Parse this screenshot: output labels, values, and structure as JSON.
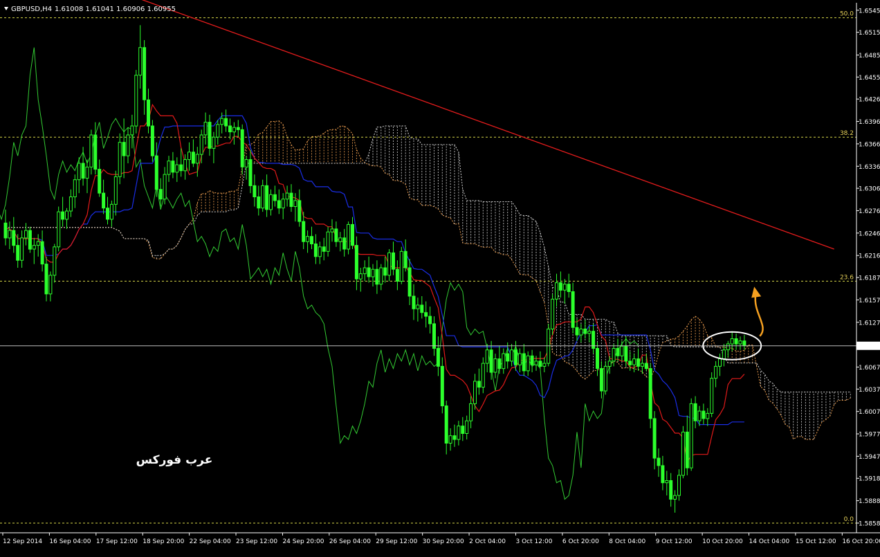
{
  "header": {
    "symbol_text": "GBPUSD,H4",
    "ohlc_text": "1.61008 1.61041 1.60906 1.60955"
  },
  "watermark": "عرب فوركس",
  "colors": {
    "background": "#000000",
    "grid": "#4a4a4a",
    "fib": "#d9d94a",
    "trendline": "#e61c1c",
    "tenkan": "#e31a1a",
    "kijun": "#1a2ee8",
    "chikou": "#33cc33",
    "bull": "#ffffff",
    "bear": "#2cff2c",
    "cloud_a": "#f0a050",
    "cloud_b": "#d8d8d8",
    "annot_arrow": "#f5a020",
    "annot_ellipse": "#ffffff"
  },
  "chart_data": {
    "type": "candlestick",
    "timeframe": "H4",
    "ylim": [
      1.5845,
      1.6555
    ],
    "y_ticks": [
      "1.65450",
      "1.65155",
      "1.64850",
      "1.64555",
      "1.64260",
      "1.63960",
      "1.63660",
      "1.63360",
      "1.63065",
      "1.62765",
      "1.62465",
      "1.62165",
      "1.61870",
      "1.61570",
      "1.61270",
      "1.60955",
      "1.60670",
      "1.60375",
      "1.60075",
      "1.59775",
      "1.59475",
      "1.59180",
      "1.58880",
      "1.58580"
    ],
    "x_ticks": [
      "12 Sep 2014",
      "16 Sep 04:00",
      "17 Sep 12:00",
      "18 Sep 20:00",
      "22 Sep 04:00",
      "23 Sep 12:00",
      "24 Sep 20:00",
      "26 Sep 04:00",
      "29 Sep 12:00",
      "30 Sep 20:00",
      "2 Oct 04:00",
      "3 Oct 12:00",
      "6 Oct 20:00",
      "8 Oct 04:00",
      "9 Oct 12:00",
      "10 Oct 20:00",
      "14 Oct 04:00",
      "15 Oct 12:00",
      "16 Oct 20:00"
    ],
    "current_price": "1.60955",
    "fib_levels": [
      {
        "label": "50.0",
        "price": 1.6535
      },
      {
        "label": "38.2",
        "price": 1.6375
      },
      {
        "label": "23.6",
        "price": 1.6182
      },
      {
        "label": "0.0",
        "price": 1.5858
      }
    ],
    "trendline": {
      "from": {
        "bar": 33,
        "price": 1.656
      },
      "to": {
        "bar": 203,
        "price": 1.6225
      }
    },
    "candles": [
      [
        1.626,
        1.6278,
        1.623,
        1.624
      ],
      [
        1.624,
        1.6262,
        1.6225,
        1.625
      ],
      [
        1.625,
        1.6268,
        1.622,
        1.623
      ],
      [
        1.623,
        1.6245,
        1.62,
        1.621
      ],
      [
        1.621,
        1.625,
        1.62,
        1.624
      ],
      [
        1.624,
        1.626,
        1.623,
        1.625
      ],
      [
        1.625,
        1.6255,
        1.622,
        1.6225
      ],
      [
        1.6225,
        1.624,
        1.6205,
        1.623
      ],
      [
        1.623,
        1.6245,
        1.6215,
        1.6235
      ],
      [
        1.6235,
        1.625,
        1.6195,
        1.6205
      ],
      [
        1.6205,
        1.6215,
        1.6155,
        1.6165
      ],
      [
        1.6165,
        1.6195,
        1.6155,
        1.619
      ],
      [
        1.619,
        1.6232,
        1.618,
        1.6228
      ],
      [
        1.6228,
        1.6282,
        1.6222,
        1.6275
      ],
      [
        1.6275,
        1.6295,
        1.6255,
        1.6265
      ],
      [
        1.6265,
        1.628,
        1.6252,
        1.6276
      ],
      [
        1.6276,
        1.6305,
        1.6268,
        1.6295
      ],
      [
        1.6295,
        1.6325,
        1.628,
        1.6318
      ],
      [
        1.6318,
        1.6348,
        1.63,
        1.634
      ],
      [
        1.634,
        1.6362,
        1.631,
        1.632
      ],
      [
        1.632,
        1.6345,
        1.63,
        1.6335
      ],
      [
        1.6335,
        1.6385,
        1.6325,
        1.6378
      ],
      [
        1.6378,
        1.6395,
        1.6325,
        1.6332
      ],
      [
        1.6332,
        1.6345,
        1.6295,
        1.63
      ],
      [
        1.63,
        1.6318,
        1.6272,
        1.628
      ],
      [
        1.628,
        1.6295,
        1.6258,
        1.6265
      ],
      [
        1.6265,
        1.629,
        1.6255,
        1.6285
      ],
      [
        1.6285,
        1.633,
        1.627,
        1.6322
      ],
      [
        1.6322,
        1.638,
        1.6312,
        1.6368
      ],
      [
        1.6368,
        1.64,
        1.632,
        1.635
      ],
      [
        1.635,
        1.6388,
        1.634,
        1.6378
      ],
      [
        1.6378,
        1.6405,
        1.636,
        1.639
      ],
      [
        1.639,
        1.6465,
        1.638,
        1.6458
      ],
      [
        1.6458,
        1.6525,
        1.644,
        1.6495
      ],
      [
        1.6495,
        1.6505,
        1.6405,
        1.6425
      ],
      [
        1.6425,
        1.644,
        1.638,
        1.639
      ],
      [
        1.639,
        1.6398,
        1.6342,
        1.635
      ],
      [
        1.635,
        1.6368,
        1.6295,
        1.6305
      ],
      [
        1.6305,
        1.632,
        1.6282,
        1.6292
      ],
      [
        1.6292,
        1.6335,
        1.6285,
        1.6325
      ],
      [
        1.6325,
        1.635,
        1.6315,
        1.6343
      ],
      [
        1.6343,
        1.6355,
        1.632,
        1.6328
      ],
      [
        1.6328,
        1.6348,
        1.6315,
        1.6338
      ],
      [
        1.6338,
        1.636,
        1.6322,
        1.633
      ],
      [
        1.633,
        1.6352,
        1.6318,
        1.6345
      ],
      [
        1.6345,
        1.6368,
        1.633,
        1.6355
      ],
      [
        1.6355,
        1.6372,
        1.6335,
        1.634
      ],
      [
        1.634,
        1.6362,
        1.6322,
        1.6352
      ],
      [
        1.6352,
        1.6385,
        1.634,
        1.6378
      ],
      [
        1.6378,
        1.6408,
        1.6365,
        1.6395
      ],
      [
        1.6395,
        1.6405,
        1.635,
        1.636
      ],
      [
        1.636,
        1.6382,
        1.634,
        1.6375
      ],
      [
        1.6375,
        1.6398,
        1.6365,
        1.6392
      ],
      [
        1.6392,
        1.6408,
        1.638,
        1.64
      ],
      [
        1.64,
        1.6412,
        1.6382,
        1.639
      ],
      [
        1.639,
        1.64,
        1.6372,
        1.6382
      ],
      [
        1.6382,
        1.6395,
        1.6365,
        1.6388
      ],
      [
        1.6388,
        1.6398,
        1.6375,
        1.6385
      ],
      [
        1.6385,
        1.6392,
        1.6325,
        1.6335
      ],
      [
        1.6335,
        1.635,
        1.6318,
        1.6345
      ],
      [
        1.6345,
        1.6358,
        1.63,
        1.631
      ],
      [
        1.631,
        1.6325,
        1.6282,
        1.6295
      ],
      [
        1.6295,
        1.631,
        1.627,
        1.628
      ],
      [
        1.628,
        1.6318,
        1.6275,
        1.631
      ],
      [
        1.631,
        1.6325,
        1.6268,
        1.6278
      ],
      [
        1.6278,
        1.6305,
        1.627,
        1.6298
      ],
      [
        1.6298,
        1.631,
        1.6282,
        1.629
      ],
      [
        1.629,
        1.6305,
        1.6272,
        1.628
      ],
      [
        1.628,
        1.63,
        1.6265,
        1.6292
      ],
      [
        1.6292,
        1.631,
        1.6282,
        1.63
      ],
      [
        1.63,
        1.6312,
        1.6275,
        1.6282
      ],
      [
        1.6282,
        1.63,
        1.6262,
        1.629
      ],
      [
        1.629,
        1.6305,
        1.6255,
        1.6262
      ],
      [
        1.6262,
        1.6275,
        1.6225,
        1.6235
      ],
      [
        1.6235,
        1.625,
        1.622,
        1.6242
      ],
      [
        1.6242,
        1.6255,
        1.6225,
        1.6232
      ],
      [
        1.6232,
        1.6245,
        1.6205,
        1.6215
      ],
      [
        1.6215,
        1.6235,
        1.6205,
        1.6228
      ],
      [
        1.6228,
        1.624,
        1.621,
        1.6222
      ],
      [
        1.6222,
        1.6255,
        1.6215,
        1.6248
      ],
      [
        1.6248,
        1.6265,
        1.6235,
        1.6252
      ],
      [
        1.6252,
        1.6262,
        1.6228,
        1.6235
      ],
      [
        1.6235,
        1.6248,
        1.6222,
        1.624
      ],
      [
        1.624,
        1.6252,
        1.6215,
        1.6225
      ],
      [
        1.6225,
        1.6262,
        1.6218,
        1.6258
      ],
      [
        1.6258,
        1.6268,
        1.6225,
        1.623
      ],
      [
        1.623,
        1.6242,
        1.617,
        1.6185
      ],
      [
        1.6185,
        1.62,
        1.6168,
        1.6192
      ],
      [
        1.6192,
        1.621,
        1.6182,
        1.62
      ],
      [
        1.62,
        1.6215,
        1.618,
        1.6188
      ],
      [
        1.6188,
        1.6205,
        1.6175,
        1.6198
      ],
      [
        1.6198,
        1.621,
        1.6165,
        1.6178
      ],
      [
        1.6178,
        1.6205,
        1.617,
        1.62
      ],
      [
        1.62,
        1.6215,
        1.618,
        1.619
      ],
      [
        1.619,
        1.6225,
        1.6182,
        1.622
      ],
      [
        1.622,
        1.6235,
        1.619,
        1.6198
      ],
      [
        1.6198,
        1.621,
        1.617,
        1.6182
      ],
      [
        1.6182,
        1.6228,
        1.6178,
        1.6222
      ],
      [
        1.6222,
        1.6238,
        1.6195,
        1.62
      ],
      [
        1.62,
        1.6212,
        1.615,
        1.6162
      ],
      [
        1.6162,
        1.6178,
        1.613,
        1.6145
      ],
      [
        1.6145,
        1.616,
        1.6128,
        1.615
      ],
      [
        1.615,
        1.6162,
        1.6132,
        1.614
      ],
      [
        1.614,
        1.6155,
        1.612,
        1.6135
      ],
      [
        1.6135,
        1.6148,
        1.6112,
        1.6125
      ],
      [
        1.6125,
        1.6135,
        1.6082,
        1.6092
      ],
      [
        1.6092,
        1.6108,
        1.6055,
        1.6068
      ],
      [
        1.6068,
        1.608,
        1.6005,
        1.6015
      ],
      [
        1.6015,
        1.6022,
        1.595,
        1.5965
      ],
      [
        1.5965,
        1.5985,
        1.5955,
        1.5975
      ],
      [
        1.5975,
        1.599,
        1.596,
        1.597
      ],
      [
        1.597,
        1.5995,
        1.5962,
        1.5988
      ],
      [
        1.5988,
        1.6,
        1.5968,
        1.5978
      ],
      [
        1.5978,
        1.6002,
        1.597,
        1.5995
      ],
      [
        1.5995,
        1.6028,
        1.5985,
        1.6018
      ],
      [
        1.6018,
        1.6058,
        1.601,
        1.6048
      ],
      [
        1.6048,
        1.6065,
        1.603,
        1.604
      ],
      [
        1.604,
        1.608,
        1.6032,
        1.6072
      ],
      [
        1.6072,
        1.6098,
        1.606,
        1.609
      ],
      [
        1.609,
        1.6102,
        1.605,
        1.606
      ],
      [
        1.606,
        1.6085,
        1.6052,
        1.6078
      ],
      [
        1.6078,
        1.6095,
        1.6058,
        1.6065
      ],
      [
        1.6065,
        1.6092,
        1.6058,
        1.6085
      ],
      [
        1.6085,
        1.61,
        1.6065,
        1.6075
      ],
      [
        1.6075,
        1.6098,
        1.6068,
        1.609
      ],
      [
        1.609,
        1.6102,
        1.6062,
        1.607
      ],
      [
        1.607,
        1.6092,
        1.606,
        1.6085
      ],
      [
        1.6085,
        1.6098,
        1.6055,
        1.6062
      ],
      [
        1.6062,
        1.6088,
        1.6055,
        1.6082
      ],
      [
        1.6082,
        1.609,
        1.606,
        1.607
      ],
      [
        1.607,
        1.6082,
        1.6062,
        1.6075
      ],
      [
        1.6075,
        1.6088,
        1.6065,
        1.6068
      ],
      [
        1.6068,
        1.608,
        1.606,
        1.6072
      ],
      [
        1.6072,
        1.6125,
        1.6068,
        1.6118
      ],
      [
        1.6118,
        1.6165,
        1.611,
        1.6158
      ],
      [
        1.6158,
        1.6192,
        1.6148,
        1.618
      ],
      [
        1.618,
        1.6195,
        1.616,
        1.617
      ],
      [
        1.617,
        1.6185,
        1.6152,
        1.6178
      ],
      [
        1.6178,
        1.6192,
        1.616,
        1.6168
      ],
      [
        1.6168,
        1.618,
        1.6112,
        1.612
      ],
      [
        1.612,
        1.6132,
        1.6102,
        1.611
      ],
      [
        1.611,
        1.6125,
        1.61,
        1.6118
      ],
      [
        1.6118,
        1.613,
        1.6105,
        1.6112
      ],
      [
        1.6112,
        1.6122,
        1.61,
        1.6115
      ],
      [
        1.6115,
        1.6125,
        1.6085,
        1.6092
      ],
      [
        1.6092,
        1.61,
        1.6055,
        1.6065
      ],
      [
        1.6065,
        1.6075,
        1.6025,
        1.6035
      ],
      [
        1.6035,
        1.6075,
        1.603,
        1.6068
      ],
      [
        1.6068,
        1.6082,
        1.6058,
        1.6075
      ],
      [
        1.6075,
        1.6098,
        1.6068,
        1.6092
      ],
      [
        1.6092,
        1.6105,
        1.6075,
        1.6082
      ],
      [
        1.6082,
        1.6102,
        1.6075,
        1.6095
      ],
      [
        1.6095,
        1.6108,
        1.6068,
        1.6075
      ],
      [
        1.6075,
        1.6088,
        1.6062,
        1.607
      ],
      [
        1.607,
        1.6085,
        1.606,
        1.6078
      ],
      [
        1.6078,
        1.6092,
        1.6062,
        1.6068
      ],
      [
        1.6068,
        1.608,
        1.6058,
        1.6072
      ],
      [
        1.6072,
        1.6085,
        1.6062,
        1.6065
      ],
      [
        1.6065,
        1.6072,
        1.5985,
        1.5998
      ],
      [
        1.5998,
        1.6008,
        1.593,
        1.5945
      ],
      [
        1.5945,
        1.5958,
        1.592,
        1.5935
      ],
      [
        1.5935,
        1.5948,
        1.5902,
        1.5912
      ],
      [
        1.5912,
        1.5928,
        1.5895,
        1.5915
      ],
      [
        1.5915,
        1.5925,
        1.588,
        1.589
      ],
      [
        1.589,
        1.5902,
        1.5872,
        1.5895
      ],
      [
        1.5895,
        1.593,
        1.5888,
        1.5922
      ],
      [
        1.5922,
        1.5988,
        1.5918,
        1.598
      ],
      [
        1.598,
        1.6002,
        1.5922,
        1.5932
      ],
      [
        1.5932,
        1.6025,
        1.5928,
        1.6018
      ],
      [
        1.6018,
        1.6028,
        1.5985,
        1.5995
      ],
      [
        1.5995,
        1.6015,
        1.5988,
        1.6008
      ],
      [
        1.6008,
        1.6018,
        1.599,
        1.5998
      ],
      [
        1.5998,
        1.6012,
        1.5988,
        1.6005
      ],
      [
        1.6005,
        1.606,
        1.6,
        1.6052
      ],
      [
        1.6052,
        1.6075,
        1.604,
        1.6068
      ],
      [
        1.6068,
        1.6085,
        1.6055,
        1.6078
      ],
      [
        1.6078,
        1.6098,
        1.6068,
        1.609
      ],
      [
        1.609,
        1.6102,
        1.608,
        1.6098
      ],
      [
        1.6098,
        1.6115,
        1.6088,
        1.6105
      ],
      [
        1.6105,
        1.6112,
        1.609,
        1.6098
      ],
      [
        1.6098,
        1.6108,
        1.609,
        1.6102
      ],
      [
        1.6102,
        1.611,
        1.609,
        1.6096
      ]
    ]
  }
}
